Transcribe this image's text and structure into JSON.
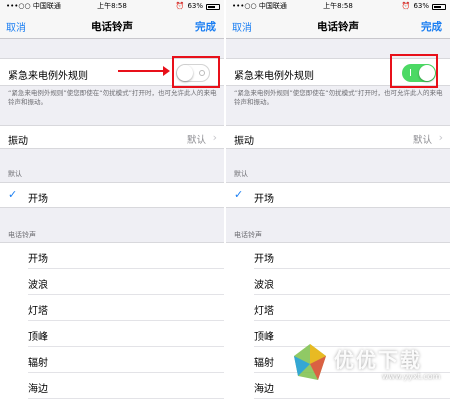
{
  "status_bar": {
    "carrier": "•••○○ 中国联通 ",
    "time": "上午8:58",
    "battery": "63%"
  },
  "nav": {
    "cancel": "取消",
    "title": "电话铃声",
    "done": "完成"
  },
  "emergency": {
    "label": "紧急来电例外规则",
    "footnote": "“紧急来电例外规则”使您即使在“勿扰模式”打开时，也可允许此人的来电铃声和振动。",
    "left_state": "off",
    "right_state": "on"
  },
  "vibration": {
    "label": "振动",
    "value": "默认"
  },
  "default_section": {
    "header": "默认",
    "selected": "开场"
  },
  "ringtones_section": {
    "header": "电话铃声",
    "items": [
      "开场",
      "波浪",
      "灯塔",
      "顶峰",
      "辐射",
      "海边"
    ]
  },
  "watermark": {
    "text": "优优下载",
    "url": "www.yyxt.com"
  },
  "colors": {
    "accent": "#1a7ef2",
    "toggle_on": "#4cd964",
    "highlight": "#e8101a"
  },
  "icons": [
    "wifi-icon",
    "location-icon",
    "alarm-icon",
    "battery-icon",
    "chevron-right-icon",
    "checkmark-icon"
  ]
}
